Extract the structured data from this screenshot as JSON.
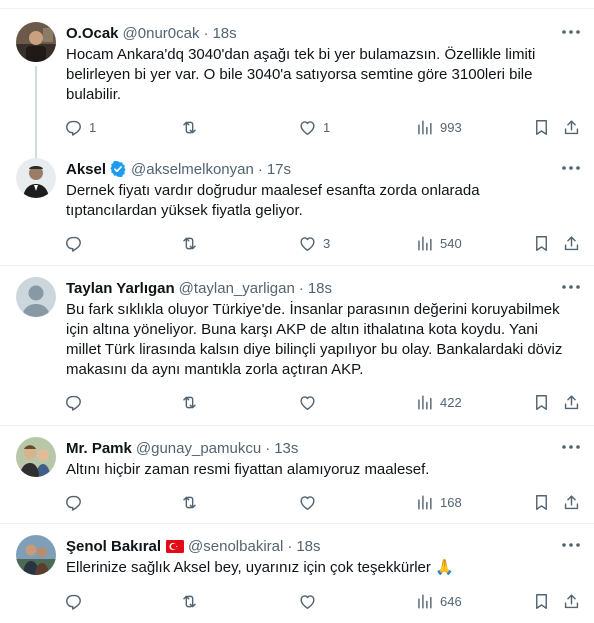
{
  "tweets": [
    {
      "name": "O.Ocak",
      "handle": "@0nur0cak",
      "time": "18s",
      "text": "Hocam Ankara'dq 3040'dan aşağı tek bi yer bulamazsın. Özellikle limiti belirleyen bi yer var. O bile 3040'a satıyorsa  semtine göre 3100leri bile bulabilir.",
      "replies": "1",
      "retweets": "",
      "likes": "1",
      "views": "993"
    },
    {
      "name": "Aksel",
      "handle": "@akselmelkonyan",
      "time": "17s",
      "verified": true,
      "text": "Dernek fiyatı vardır doğrudur maalesef esanfta zorda onlarada tıptancılardan yüksek fiyatla geliyor.",
      "replies": "",
      "retweets": "",
      "likes": "3",
      "views": "540"
    },
    {
      "name": "Taylan Yarlıgan",
      "handle": "@taylan_yarligan",
      "time": "18s",
      "text": "Bu fark sıklıkla oluyor Türkiye'de. İnsanlar parasının değerini koruyabilmek için altına yöneliyor. Buna karşı AKP de altın ithalatına kota koydu. Yani millet Türk lirasında kalsın diye bilinçli yapılıyor bu olay. Bankalardaki döviz makasını da aynı mantıkla zorla açtıran AKP.",
      "replies": "",
      "retweets": "",
      "likes": "",
      "views": "422"
    },
    {
      "name": "Mr. Pamk",
      "handle": "@gunay_pamukcu",
      "time": "13s",
      "text": "Altını hiçbir zaman resmi fiyattan alamıyoruz maalesef.",
      "replies": "",
      "retweets": "",
      "likes": "",
      "views": "168"
    },
    {
      "name": "Şenol Bakıral",
      "handle": "@senolbakiral",
      "time": "18s",
      "flag": true,
      "text": "Ellerinize sağlık Aksel bey, uyarınız için çok teşekkürler 🙏",
      "replies": "",
      "retweets": "",
      "likes": "",
      "views": "646"
    }
  ],
  "colors": {
    "text": "#0f1419",
    "secondary": "#536471",
    "verified": "#1d9bf0",
    "divider": "#eff3f4",
    "thread_line": "#cfd9de"
  },
  "icons": [
    "more-icon",
    "reply-icon",
    "retweet-icon",
    "like-icon",
    "views-icon",
    "bookmark-icon",
    "share-icon",
    "verified-badge-icon",
    "turkey-flag-icon"
  ]
}
